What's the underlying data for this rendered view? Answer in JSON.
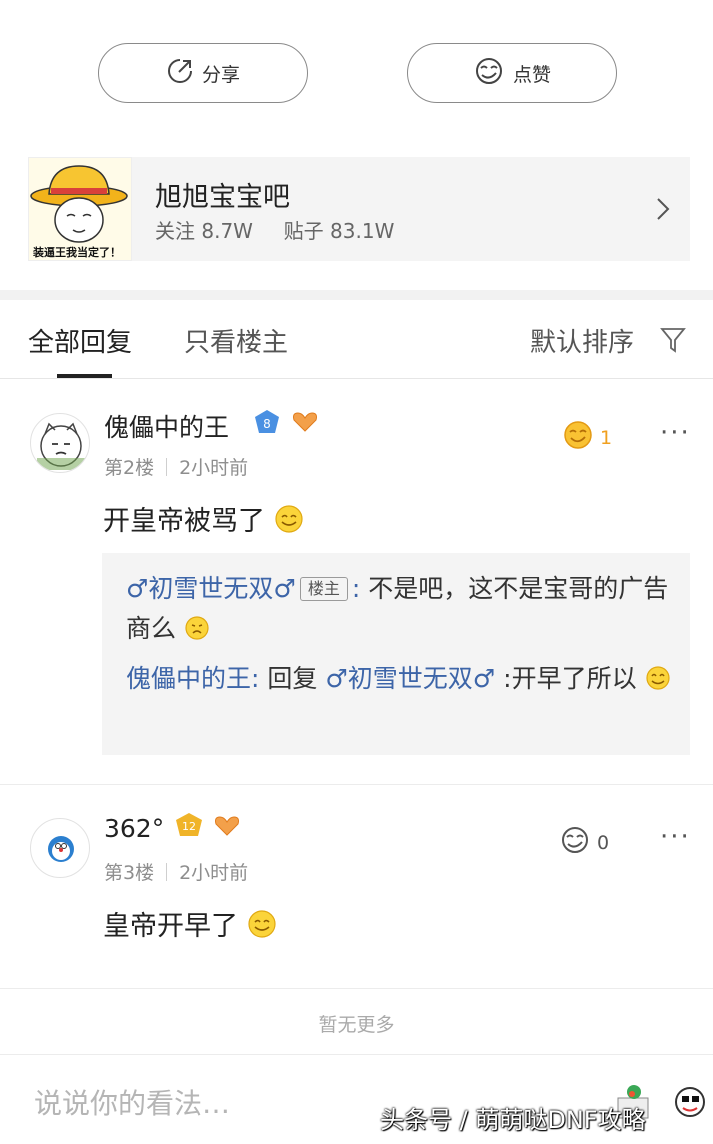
{
  "actions": {
    "share_label": "分享",
    "like_label": "点赞"
  },
  "forum": {
    "name": "旭旭宝宝吧",
    "avatar_caption": "装逼王我当定了！",
    "followers_label": "关注",
    "followers_value": "8.7W",
    "posts_label": "贴子",
    "posts_value": "83.1W"
  },
  "tabs": {
    "all": "全部回复",
    "owner_only": "只看楼主",
    "sort": "默认排序"
  },
  "comments": [
    {
      "user": "傀儡中的王",
      "level": "8",
      "floor": "第2楼",
      "time": "2小时前",
      "text": "开皇帝被骂了",
      "likes": "1",
      "replies": [
        {
          "author": "♂初雪世无双♂",
          "tag": "楼主",
          "text": "不是吧，这不是宝哥的广告商么"
        },
        {
          "author": "傀儡中的王",
          "reply_word": "回复",
          "target": "♂初雪世无双♂",
          "text": ":开早了所以"
        }
      ]
    },
    {
      "user": "362°",
      "level": "12",
      "floor": "第3楼",
      "time": "2小时前",
      "text": "皇帝开早了",
      "likes": "0"
    }
  ],
  "footer": {
    "no_more": "暂无更多",
    "input_placeholder": "说说你的看法…",
    "watermark": "头条号 / 萌萌哒DNF攻略"
  },
  "colors": {
    "link_blue": "#3d65a8",
    "level_blue": "#4a90e2",
    "level_gold": "#f0b429",
    "heart_orange": "#f08a24"
  }
}
